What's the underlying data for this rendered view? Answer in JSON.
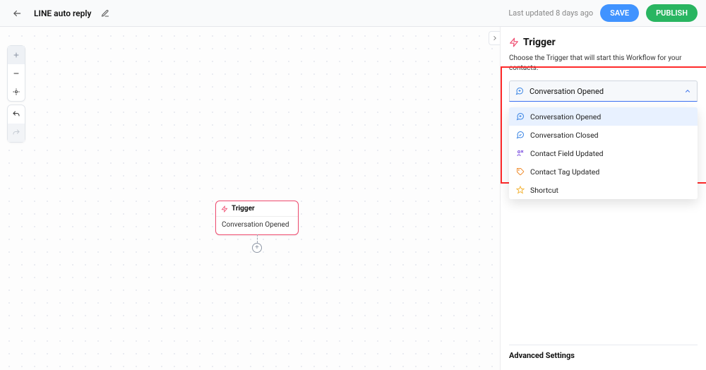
{
  "header": {
    "title": "LINE auto reply",
    "last_updated": "Last updated 8 days ago",
    "save_label": "SAVE",
    "publish_label": "PUBLISH"
  },
  "node": {
    "title": "Trigger",
    "subtitle": "Conversation Opened"
  },
  "panel": {
    "title": "Trigger",
    "description": "Choose the Trigger that will start this Workflow for your contacts.",
    "selected": "Conversation Opened",
    "options": {
      "0": {
        "label": "Conversation Opened"
      },
      "1": {
        "label": "Conversation Closed"
      },
      "2": {
        "label": "Contact Field Updated"
      },
      "3": {
        "label": "Contact Tag Updated"
      },
      "4": {
        "label": "Shortcut"
      }
    },
    "advanced_label": "Advanced Settings"
  }
}
